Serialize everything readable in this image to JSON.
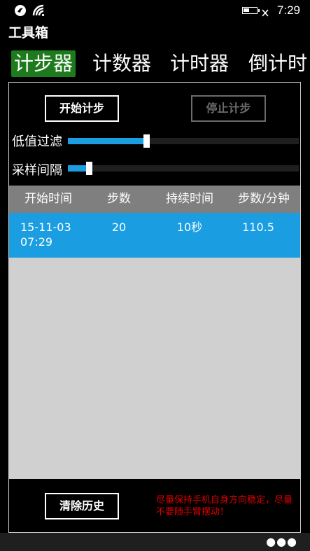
{
  "status_bar": {
    "time": "7:29",
    "icons": [
      "notification-icon",
      "signal-icon",
      "battery-icon"
    ],
    "battery_level_percent": 45
  },
  "app": {
    "title": "工具箱"
  },
  "tabs": [
    {
      "label": "计步器",
      "active": true
    },
    {
      "label": "计数器",
      "active": false
    },
    {
      "label": "计时器",
      "active": false
    },
    {
      "label": "倒计时",
      "active": false
    }
  ],
  "controls": {
    "start_label": "开始计步",
    "stop_label": "停止计步",
    "stop_enabled": false
  },
  "sliders": [
    {
      "label": "低值过滤",
      "value_percent": 34
    },
    {
      "label": "采样间隔",
      "value_percent": 9
    }
  ],
  "history": {
    "columns": [
      "开始时间",
      "步数",
      "持续时间",
      "步数/分钟"
    ],
    "rows": [
      {
        "start_time": "15-11-03 07:29",
        "steps": "20",
        "duration": "10秒",
        "steps_per_minute": "110.5"
      }
    ]
  },
  "footer": {
    "clear_label": "清除历史",
    "tip": "尽量保持手机自身方向稳定，尽量不要随手臂摆动！"
  },
  "colors": {
    "accent": "#1b9de2",
    "active_tab": "#1d7a1d",
    "tip_text": "#e00000",
    "header_bg": "#7f7f7f",
    "list_bg": "#d0d0d0"
  }
}
